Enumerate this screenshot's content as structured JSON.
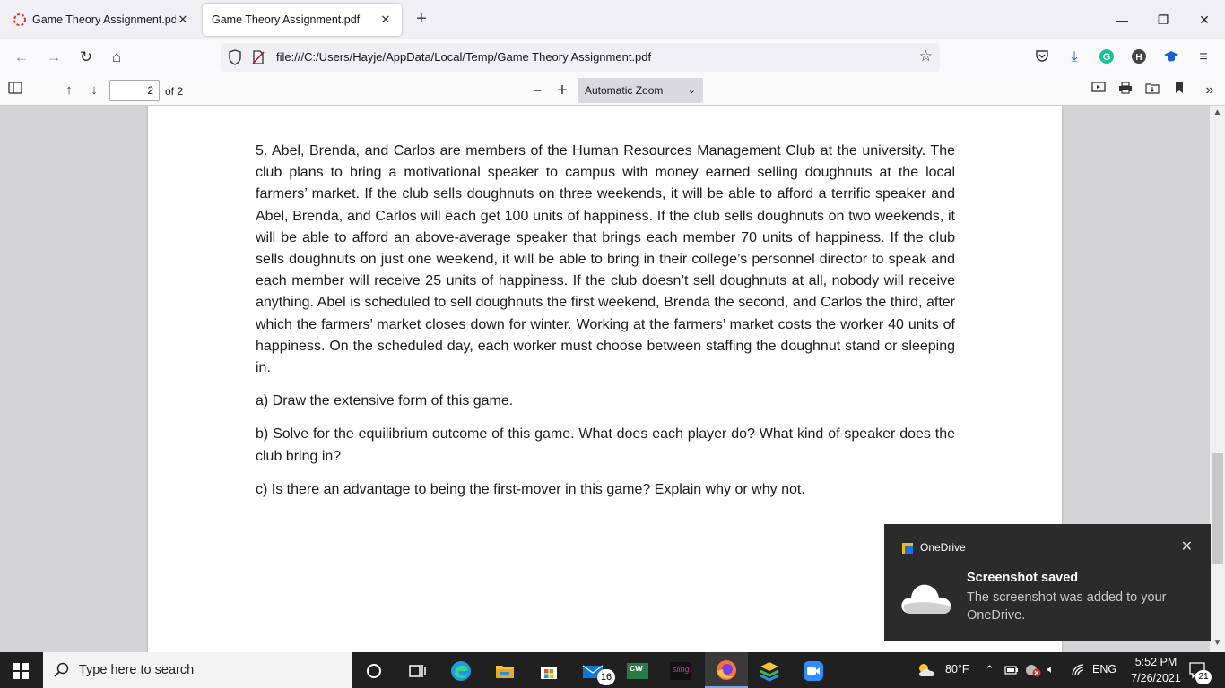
{
  "tabs": [
    {
      "title": "Game Theory Assignment.pdf: |"
    },
    {
      "title": "Game Theory Assignment.pdf"
    }
  ],
  "window": {
    "new_tab": "+",
    "minimize": "—",
    "restore": "❐",
    "close": "✕"
  },
  "nav": {
    "url": "file:///C:/Users/Hayje/AppData/Local/Temp/Game Theory Assignment.pdf"
  },
  "pdf_toolbar": {
    "page_number": "2",
    "page_count": "of 2",
    "zoom": "Automatic Zoom"
  },
  "document": {
    "paragraphs": [
      "5. Abel, Brenda, and Carlos are members of the Human Resources Management Club at the university. The club plans to bring a motivational speaker to campus with money earned selling doughnuts at the local farmers’ market.  If the club sells doughnuts on three weekends, it will be able to afford a terrific speaker and Abel, Brenda, and Carlos will each get 100 units of happiness.  If the club sells doughnuts on two weekends, it will be able to afford an above-average speaker that brings each member 70 units of happiness.  If the club sells doughnuts on just one weekend, it will be able to bring in their college’s personnel director to speak and each member will receive 25 units of happiness.  If the club doesn’t sell doughnuts at all, nobody will receive anything.  Abel is scheduled to sell doughnuts the first weekend, Brenda the second, and Carlos the third, after which the farmers’ market closes down for winter. Working at the farmers’ market costs the worker 40 units of happiness.  On the scheduled day, each worker must choose between staffing the doughnut stand or sleeping in.",
      "a) Draw the extensive form of this game.",
      "b) Solve for the equilibrium outcome of this game.  What does each player do? What kind of speaker does the club bring in?",
      "c) Is there an advantage to being the first-mover in this game? Explain why or why not."
    ]
  },
  "toast": {
    "app": "OneDrive",
    "title": "Screenshot saved",
    "message": "The screenshot was added to your OneDrive."
  },
  "taskbar": {
    "search_placeholder": "Type here to search",
    "mail_badge": "16",
    "cw_label": "cw",
    "sling_label": "sling",
    "weather": "80°F",
    "language": "ENG",
    "time": "5:52 PM",
    "date": "7/26/2021",
    "notification_count": "21"
  }
}
